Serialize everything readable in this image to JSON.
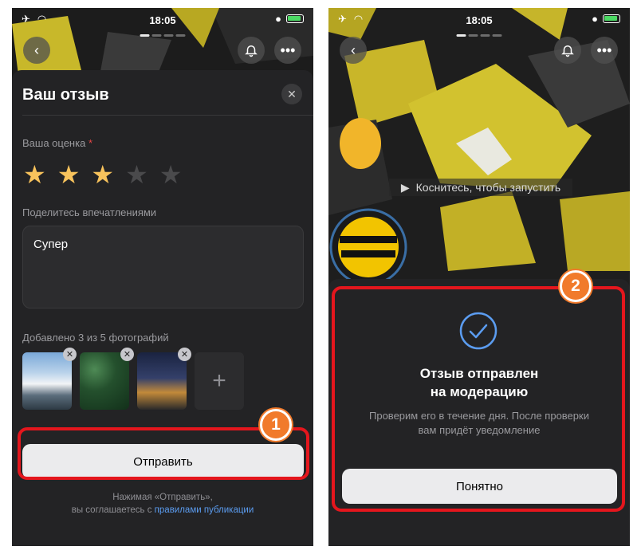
{
  "status_bar": {
    "time": "18:05"
  },
  "review_form": {
    "title": "Ваш отзыв",
    "close_icon": "✕",
    "rating_label": "Ваша оценка",
    "required_mark": "*",
    "rating": {
      "value": 3,
      "max": 5
    },
    "impressions_label": "Поделитесь впечатлениями",
    "impressions_value": "Супер",
    "photos_label": "Добавлено 3 из 5 фотографий",
    "photo_remove_icon": "✕",
    "add_photo_icon": "+",
    "submit_label": "Отправить",
    "hint_prefix": "Нажимая «Отправить»,",
    "hint_middle": "вы соглашаетесь с ",
    "hint_link": "правилами публикации"
  },
  "story": {
    "play_hint": "Коснитесь, чтобы запустить"
  },
  "confirmation": {
    "title_line1": "Отзыв отправлен",
    "title_line2": "на модерацию",
    "text_line1": "Проверим его в течение дня. После проверки",
    "text_line2": "вам придёт уведомление",
    "ok_label": "Понятно"
  },
  "annotations": {
    "step1": "1",
    "step2": "2"
  },
  "colors": {
    "highlight": "#e4161d",
    "badge": "#f17a2b",
    "star": "#f8c35c",
    "accent_blue": "#5b9cf0"
  }
}
